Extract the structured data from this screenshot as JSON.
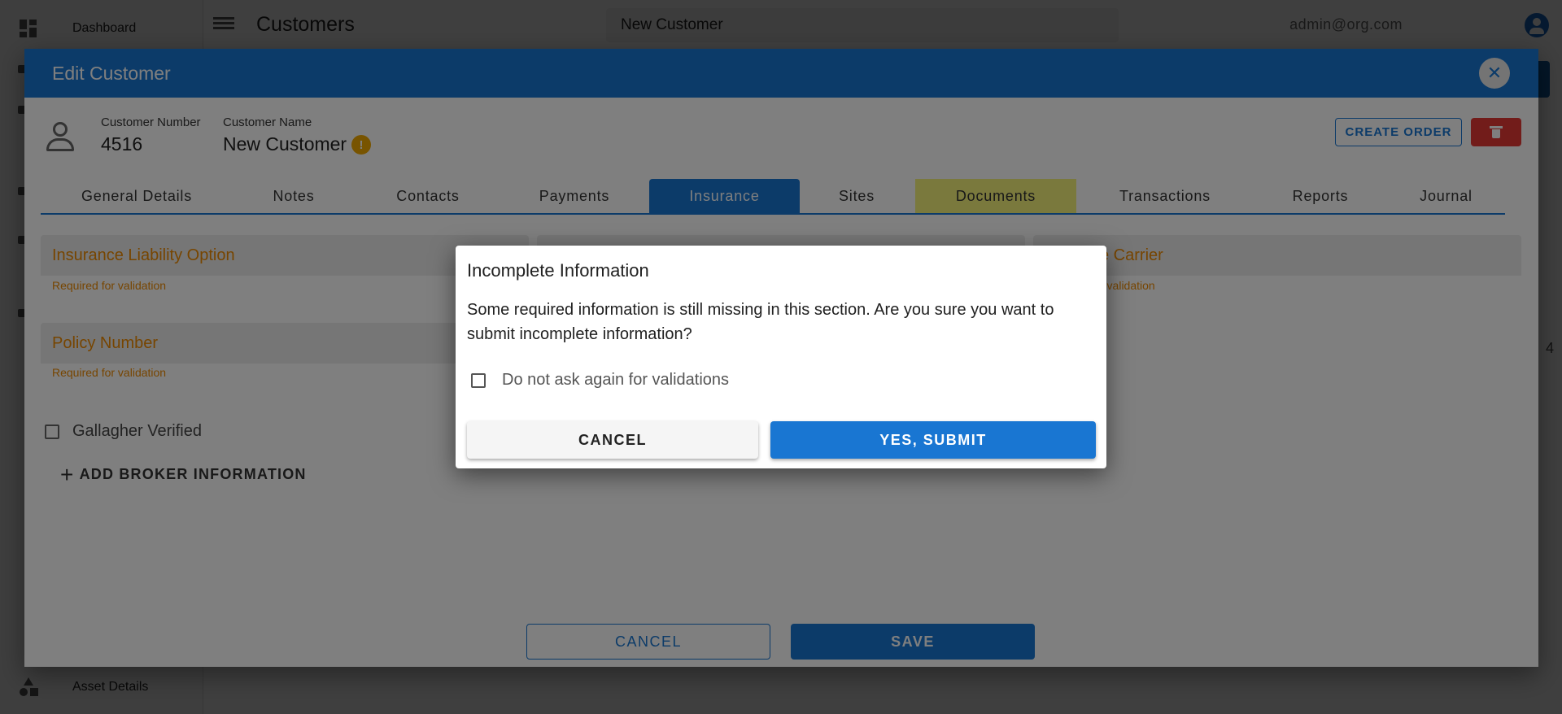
{
  "app": {
    "sidebar": {
      "top_item": "Dashboard",
      "bottom_item": "Asset Details"
    },
    "page_title": "Customers",
    "search_value": "New Customer",
    "user_email": "admin@org.com",
    "background_row_value": "4"
  },
  "edit_dialog": {
    "title": "Edit Customer",
    "customer_number_label": "Customer Number",
    "customer_number": "4516",
    "customer_name_label": "Customer Name",
    "customer_name": "New Customer",
    "warning_badge": "!",
    "create_order_label": "CREATE ORDER",
    "tabs": [
      {
        "label": "General Details"
      },
      {
        "label": "Notes"
      },
      {
        "label": "Contacts"
      },
      {
        "label": "Payments"
      },
      {
        "label": "Insurance"
      },
      {
        "label": "Sites"
      },
      {
        "label": "Documents"
      },
      {
        "label": "Transactions"
      },
      {
        "label": "Reports"
      },
      {
        "label": "Journal"
      }
    ],
    "active_tab": "Insurance",
    "fields": {
      "liability_option": "Insurance Liability Option",
      "carrier": "e Carrier",
      "policy_number": "Policy Number",
      "required_help": "Required for validation",
      "carrier_help": "r validation"
    },
    "gallagher_label": "Gallagher Verified",
    "add_broker_label": "ADD BROKER INFORMATION",
    "cancel_label": "CANCEL",
    "save_label": "SAVE"
  },
  "confirm_dialog": {
    "title": "Incomplete Information",
    "message": "Some required information is still missing in this section. Are you sure you want to submit incomplete information?",
    "checkbox_label": "Do not ask again for validations",
    "cancel_label": "CANCEL",
    "submit_label": "YES, SUBMIT"
  },
  "colors": {
    "primary": "#1976d2",
    "warning": "#ef8a00",
    "danger": "#e53935",
    "documents_tab_highlight": "#f5f27a"
  }
}
